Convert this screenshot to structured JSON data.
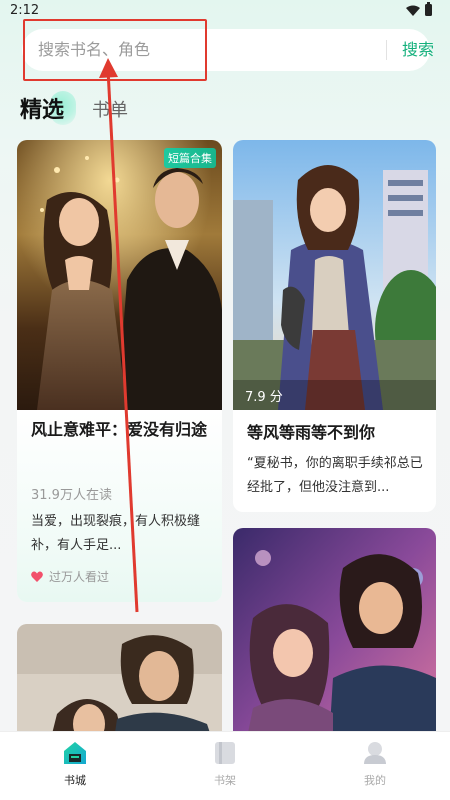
{
  "status_bar": {
    "time": "2:12"
  },
  "search": {
    "placeholder": "搜索书名、角色",
    "button_label": "搜索"
  },
  "tabs": [
    {
      "label": "精选",
      "active": true
    },
    {
      "label": "书单",
      "active": false
    }
  ],
  "books": [
    {
      "badge": "短篇合集",
      "title": "风止意难平：爱没有归途",
      "readers": "31.9万人在读",
      "summary": "当爱，出现裂痕，有人积极缝补，有人手足...",
      "views": "过万人看过"
    },
    {
      "score": "7.9 分",
      "title": "等风等雨等不到你",
      "summary": "“夏秘书，你的离职手续祁总已经批了，但他没注意到..."
    }
  ],
  "bottom_nav": [
    {
      "label": "书城",
      "icon": "home-icon",
      "active": true
    },
    {
      "label": "书架",
      "icon": "bookshelf-icon",
      "active": false
    },
    {
      "label": "我的",
      "icon": "profile-icon",
      "active": false
    }
  ],
  "colors": {
    "accent": "#14b07c",
    "annotation": "#e03a2f"
  }
}
